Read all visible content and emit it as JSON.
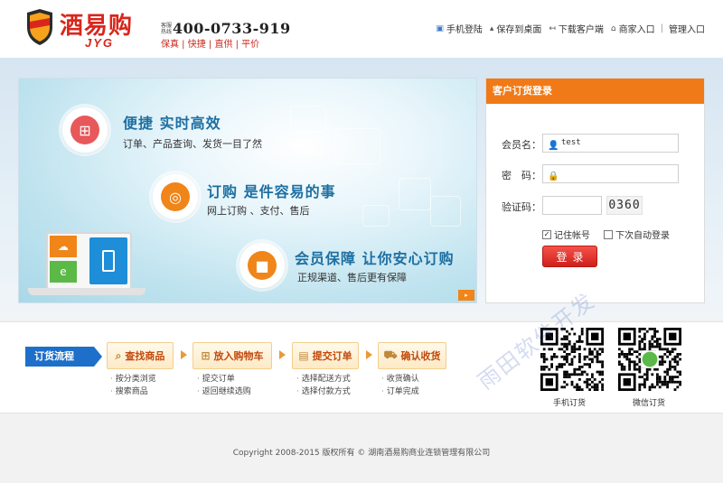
{
  "header": {
    "brand": "酒易购",
    "brand_sub": "JYG",
    "hotline_label": "客服热线",
    "hotline_number": "400-0733-919",
    "hotline_tags": "保真 | 快捷 | 直供 | 平价",
    "links": [
      {
        "label": "手机登陆",
        "icon": "mobile-icon"
      },
      {
        "label": "保存到桌面",
        "icon": "pin-icon"
      },
      {
        "label": "下载客户端",
        "icon": "download-arrow-icon"
      },
      {
        "label": "商家入口",
        "icon": "home-icon"
      },
      {
        "label": "管理入口",
        "icon": ""
      }
    ]
  },
  "banner": {
    "features": [
      {
        "title": "便捷 实时高效",
        "desc": "订单、产品查询、发货一目了然",
        "icon": "cart-icon",
        "color": "#e8585a"
      },
      {
        "title": "订购 是件容易的事",
        "desc": "网上订购 、支付、售后",
        "icon": "globe-icon",
        "color": "#f08519"
      },
      {
        "title": "会员保障 让你安心订购",
        "desc": "正规渠道、售后更有保障",
        "icon": "lock-icon",
        "color": "#f08519"
      }
    ]
  },
  "login": {
    "title": "客户订货登录",
    "username_label": "会员名：",
    "username_value": "test",
    "password_label": "密　码：",
    "captcha_label": "验证码：",
    "captcha_value": "0360",
    "remember_label": "记住帐号",
    "remember_checked": true,
    "autologin_label": "下次自动登录",
    "autologin_checked": false,
    "submit_label": "登录"
  },
  "process": {
    "label": "订货流程",
    "steps": [
      {
        "title": "查找商品",
        "icon": "search-icon",
        "subs": [
          "按分类浏览",
          "搜索商品"
        ]
      },
      {
        "title": "放入购物车",
        "icon": "cart-icon",
        "subs": [
          "提交订单",
          "返回继续选购"
        ]
      },
      {
        "title": "提交订单",
        "icon": "document-icon",
        "subs": [
          "选择配送方式",
          "选择付款方式"
        ]
      },
      {
        "title": "确认收货",
        "icon": "truck-icon",
        "subs": [
          "收货确认",
          "订单完成"
        ]
      }
    ],
    "qr": [
      {
        "label": "手机订货"
      },
      {
        "label": "微信订货"
      }
    ]
  },
  "footer": {
    "copyright": "Copyright 2008-2015 版权所有 © 湖南酒易购商业连锁管理有限公司"
  },
  "watermark": "雨田软件开发"
}
